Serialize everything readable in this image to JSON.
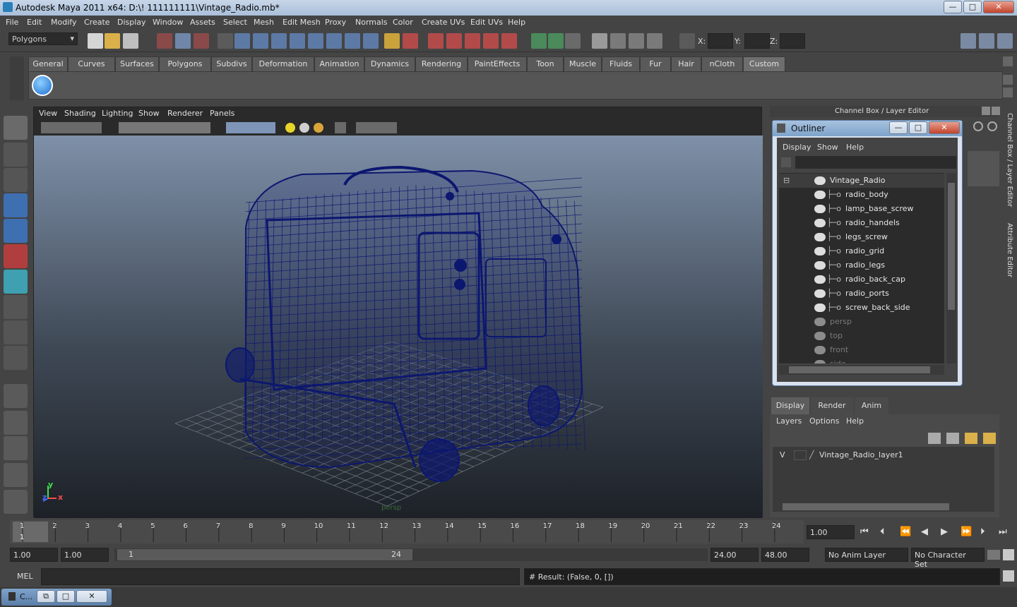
{
  "window": {
    "title": "Autodesk Maya 2011 x64: D:\\! 111111111\\Vintage_Radio.mb*",
    "buttons": {
      "min": "—",
      "max": "□",
      "close": "✕"
    }
  },
  "menus": [
    "File",
    "Edit",
    "Modify",
    "Create",
    "Display",
    "Window",
    "Assets",
    "Select",
    "Mesh",
    "Edit Mesh",
    "Proxy",
    "Normals",
    "Color",
    "Create UVs",
    "Edit UVs",
    "Help"
  ],
  "status": {
    "mode": "Polygons",
    "x_label": "X:",
    "y_label": "Y:",
    "z_label": "Z:"
  },
  "shelf": {
    "tabs": [
      "General",
      "Curves",
      "Surfaces",
      "Polygons",
      "Subdivs",
      "Deformation",
      "Animation",
      "Dynamics",
      "Rendering",
      "PaintEffects",
      "Toon",
      "Muscle",
      "Fluids",
      "Fur",
      "Hair",
      "nCloth",
      "Custom"
    ],
    "active": "Custom"
  },
  "viewport": {
    "menus": [
      "View",
      "Shading",
      "Lighting",
      "Show",
      "Renderer",
      "Panels"
    ],
    "axis_y": "y",
    "axis_x": "x",
    "axis_z": "z",
    "cam_label": "persp",
    "wire_color": "#0c1770"
  },
  "channelbox": {
    "title": "Channel Box / Layer Editor",
    "side_tabs": [
      "Channel Box / Layer Editor",
      "Attribute Editor"
    ]
  },
  "outliner": {
    "title": "Outliner",
    "menus": [
      "Display",
      "Show",
      "Help"
    ],
    "items": [
      {
        "label": "Vintage_Radio",
        "kind": "group"
      },
      {
        "label": "radio_body",
        "kind": "child"
      },
      {
        "label": "lamp_base_screw",
        "kind": "child"
      },
      {
        "label": "radio_handels",
        "kind": "child"
      },
      {
        "label": "legs_screw",
        "kind": "child"
      },
      {
        "label": "radio_grid",
        "kind": "child"
      },
      {
        "label": "radio_legs",
        "kind": "child"
      },
      {
        "label": "radio_back_cap",
        "kind": "child"
      },
      {
        "label": "radio_ports",
        "kind": "child"
      },
      {
        "label": "screw_back_side",
        "kind": "child"
      },
      {
        "label": "persp",
        "kind": "camera"
      },
      {
        "label": "top",
        "kind": "camera"
      },
      {
        "label": "front",
        "kind": "camera"
      },
      {
        "label": "side",
        "kind": "camera"
      }
    ]
  },
  "layer_editor": {
    "tabs": [
      "Display",
      "Render",
      "Anim"
    ],
    "active": "Display",
    "menus": [
      "Layers",
      "Options",
      "Help"
    ],
    "layer": {
      "visible": "V",
      "name": "Vintage_Radio_layer1"
    }
  },
  "timeline": {
    "ticks": [
      "1",
      "2",
      "3",
      "4",
      "5",
      "6",
      "7",
      "8",
      "9",
      "10",
      "11",
      "12",
      "13",
      "14",
      "15",
      "16",
      "17",
      "18",
      "19",
      "20",
      "21",
      "22",
      "23",
      "24"
    ],
    "current_frame": "1",
    "current_field": "1.00"
  },
  "range": {
    "start": "1.00",
    "start2": "1.00",
    "slider_start": "1",
    "slider_end": "24",
    "end": "24.00",
    "end2": "48.00",
    "anim_layer": "No Anim Layer",
    "char_set": "No Character Set"
  },
  "cmd": {
    "label": "MEL",
    "result": "# Result: (False, 0, [])"
  },
  "taskbar": {
    "label": "C..."
  }
}
